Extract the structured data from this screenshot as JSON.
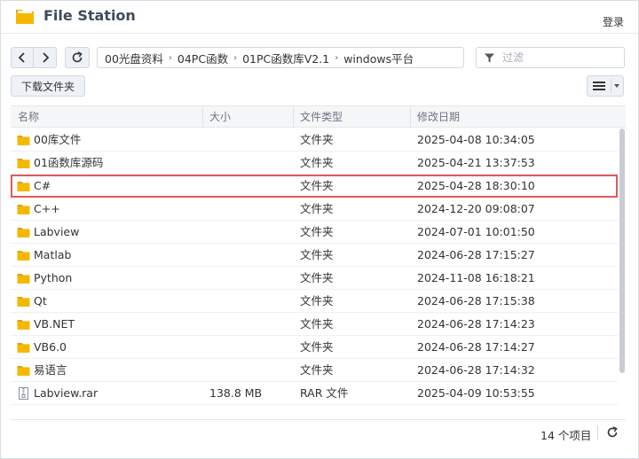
{
  "window": {
    "title": "File Station",
    "login_label": "登录"
  },
  "toolbar": {
    "breadcrumbs": [
      "00光盘资料",
      "04PC函数",
      "01PC函数库V2.1",
      "windows平台"
    ],
    "filter_placeholder": "过滤",
    "download_label": "下载文件夹"
  },
  "table": {
    "columns": [
      "名称",
      "大小",
      "文件类型",
      "修改日期"
    ],
    "rows": [
      {
        "name": "00库文件",
        "size": "",
        "type": "文件夹",
        "date": "2025-04-08 10:34:05",
        "kind": "folder-icon"
      },
      {
        "name": "01函数库源码",
        "size": "",
        "type": "文件夹",
        "date": "2025-04-21 13:37:53",
        "kind": "folder-icon"
      },
      {
        "name": "C#",
        "size": "",
        "type": "文件夹",
        "date": "2025-04-28 18:30:10",
        "kind": "folder-icon"
      },
      {
        "name": "C++",
        "size": "",
        "type": "文件夹",
        "date": "2024-12-20 09:08:07",
        "kind": "folder-icon"
      },
      {
        "name": "Labview",
        "size": "",
        "type": "文件夹",
        "date": "2024-07-01 10:01:50",
        "kind": "folder-icon"
      },
      {
        "name": "Matlab",
        "size": "",
        "type": "文件夹",
        "date": "2024-06-28 17:15:27",
        "kind": "folder-icon"
      },
      {
        "name": "Python",
        "size": "",
        "type": "文件夹",
        "date": "2024-11-08 16:18:21",
        "kind": "folder-icon"
      },
      {
        "name": "Qt",
        "size": "",
        "type": "文件夹",
        "date": "2024-06-28 17:15:38",
        "kind": "folder-icon"
      },
      {
        "name": "VB.NET",
        "size": "",
        "type": "文件夹",
        "date": "2024-06-28 17:14:23",
        "kind": "folder-icon"
      },
      {
        "name": "VB6.0",
        "size": "",
        "type": "文件夹",
        "date": "2024-06-28 17:14:27",
        "kind": "folder-icon"
      },
      {
        "name": "易语言",
        "size": "",
        "type": "文件夹",
        "date": "2024-06-28 17:14:32",
        "kind": "folder-icon"
      },
      {
        "name": "Labview.rar",
        "size": "138.8 MB",
        "type": "RAR 文件",
        "date": "2025-04-09 10:53:55",
        "kind": "archive-icon"
      }
    ],
    "highlighted_row": 2,
    "highlight_color": "#e05a5a"
  },
  "footer": {
    "item_count": "14 个项目"
  },
  "colors": {
    "folder": "#f5b800",
    "folder_dark": "#e2a300",
    "accent_border": "#d3d8df"
  }
}
